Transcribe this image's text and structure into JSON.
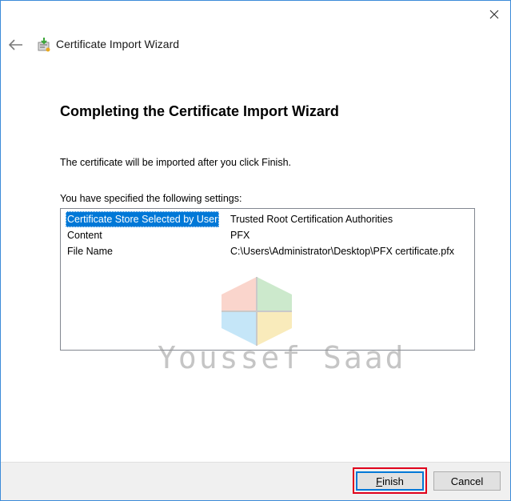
{
  "window": {
    "close_glyph": "✕"
  },
  "header": {
    "back_icon": "back-arrow-icon",
    "wizard_icon": "certificate-wizard-icon",
    "title": "Certificate Import Wizard"
  },
  "main": {
    "heading": "Completing the Certificate Import Wizard",
    "info": "The certificate will be imported after you click Finish.",
    "settings_label": "You have specified the following settings:",
    "settings": [
      {
        "key": "Certificate Store Selected by User",
        "value": "Trusted Root Certification Authorities",
        "selected": true
      },
      {
        "key": "Content",
        "value": "PFX",
        "selected": false
      },
      {
        "key": "File Name",
        "value": "C:\\Users\\Administrator\\Desktop\\PFX certificate.pfx",
        "selected": false
      }
    ]
  },
  "watermark": {
    "text": "Youssef Saad",
    "logo_colors": [
      "#f4a38f",
      "#8fd08f",
      "#80c8f0",
      "#f2d46a"
    ]
  },
  "footer": {
    "finish_label": "Finish",
    "cancel_label": "Cancel"
  },
  "colors": {
    "accent": "#0078d7",
    "highlight": "#e0001b",
    "window_border": "#3c8bd9"
  }
}
